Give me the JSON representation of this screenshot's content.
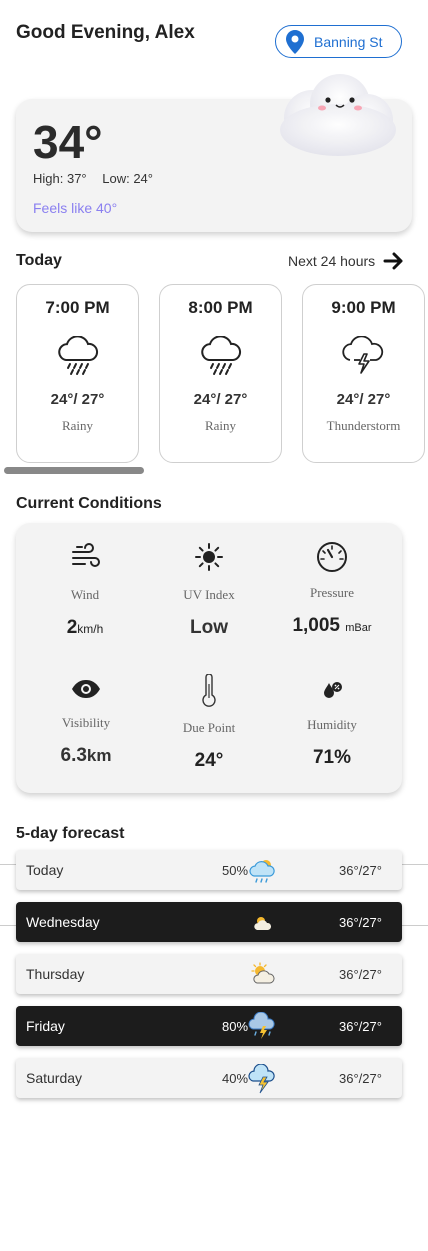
{
  "header": {
    "greeting": "Good Evening, Alex",
    "location": "Banning St"
  },
  "current": {
    "temperature": "34°",
    "high": "High: 37°",
    "low": "Low: 24°",
    "feels_like": "Feels like 40°"
  },
  "today": {
    "title": "Today",
    "next_link": "Next 24 hours",
    "hours": [
      {
        "time": "7:00 PM",
        "temps": "24°/ 27°",
        "condition": "Rainy",
        "icon": "rain-cloud-icon"
      },
      {
        "time": "8:00 PM",
        "temps": "24°/ 27°",
        "condition": "Rainy",
        "icon": "rain-cloud-icon"
      },
      {
        "time": "9:00 PM",
        "temps": "24°/ 27°",
        "condition": "Thunderstorm",
        "icon": "thunder-cloud-icon"
      }
    ]
  },
  "conditions": {
    "title": "Current Conditions",
    "wind": {
      "label": "Wind",
      "value": "2",
      "unit": "km/h",
      "icon": "wind-icon"
    },
    "uv": {
      "label": "UV Index",
      "value": "Low",
      "icon": "sun-icon"
    },
    "pressure": {
      "label": "Pressure",
      "value": "1,005",
      "unit": "mBar",
      "icon": "gauge-icon"
    },
    "visibility": {
      "label": "Visibility",
      "value": "6.3",
      "unit": "km",
      "icon": "eye-icon"
    },
    "dew_point": {
      "label": "Due Point",
      "value": "24°",
      "icon": "thermometer-icon"
    },
    "humidity": {
      "label": "Humidity",
      "value": "71%",
      "icon": "humidity-icon"
    }
  },
  "forecast": {
    "title": "5-day forecast",
    "days": [
      {
        "day": "Today",
        "chance": "50%",
        "temps": "36°/27°",
        "icon": "rain-cloud-icon",
        "style": "light"
      },
      {
        "day": "Wednesday",
        "chance": "",
        "temps": "36°/27°",
        "icon": "partly-cloudy-icon",
        "style": "dark"
      },
      {
        "day": "Thursday",
        "chance": "",
        "temps": "36°/27°",
        "icon": "partly-cloudy-icon",
        "style": "light"
      },
      {
        "day": "Friday",
        "chance": "80%",
        "temps": "36°/27°",
        "icon": "storm-cloud-icon",
        "style": "dark"
      },
      {
        "day": "Saturday",
        "chance": "40%",
        "temps": "36°/27°",
        "icon": "thunder-cloud-icon",
        "style": "light"
      }
    ]
  },
  "colors": {
    "accent_blue": "#1f6fd1",
    "feels_purple": "#8a7ff0",
    "card_bg": "#f3f3f3",
    "dark_row": "#1c1c1c"
  }
}
